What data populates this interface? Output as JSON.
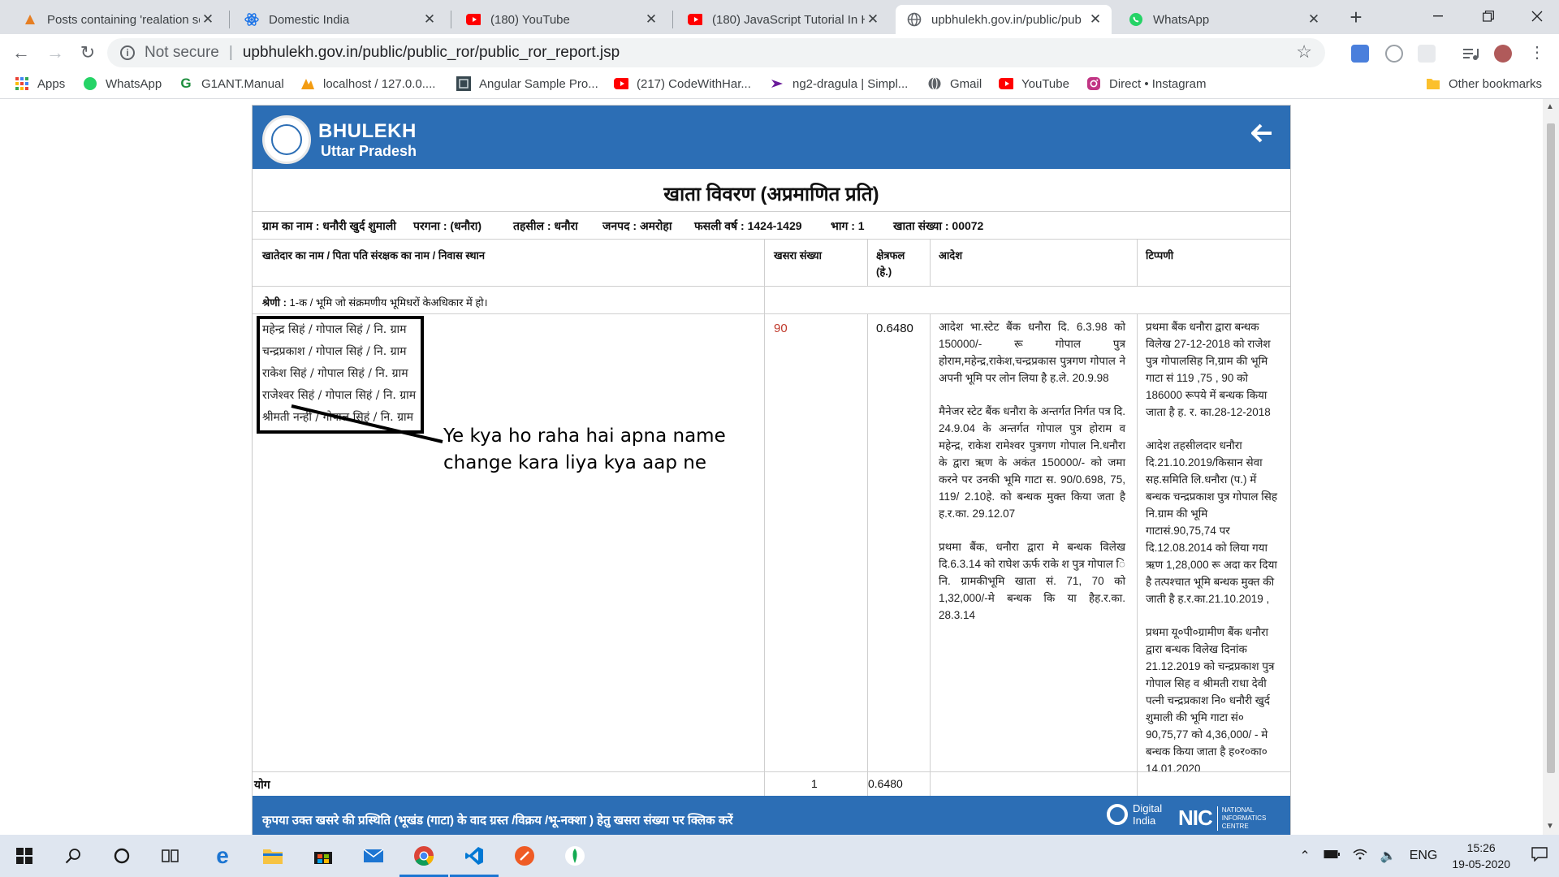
{
  "browser": {
    "tabs": [
      {
        "title": "Posts containing 'realation sc",
        "favicon": "blog-icon",
        "color": "#e67e22"
      },
      {
        "title": "Domestic India",
        "favicon": "react-icon",
        "color": "#1a73e8"
      },
      {
        "title": "(180) YouTube",
        "favicon": "youtube-icon",
        "color": "#ff0000"
      },
      {
        "title": "(180) JavaScript Tutorial In H",
        "favicon": "youtube-icon",
        "color": "#ff0000"
      },
      {
        "title": "upbhulekh.gov.in/public/pub",
        "favicon": "globe-icon",
        "color": "#5f6368"
      },
      {
        "title": "WhatsApp",
        "favicon": "whatsapp-icon",
        "color": "#25d366"
      }
    ],
    "address": {
      "security_label": "Not secure",
      "url": "upbhulekh.gov.in/public/public_ror/public_ror_report.jsp"
    },
    "bookmarks": [
      {
        "label": "Apps",
        "icon": "apps-grid-icon"
      },
      {
        "label": "WhatsApp",
        "icon": "whatsapp-icon"
      },
      {
        "label": "G1ANT.Manual",
        "icon": "g1ant-icon"
      },
      {
        "label": "localhost / 127.0.0....",
        "icon": "phpmyadmin-icon"
      },
      {
        "label": "Angular Sample Pro...",
        "icon": "angular-icon"
      },
      {
        "label": "(217) CodeWithHar...",
        "icon": "youtube-icon"
      },
      {
        "label": "ng2-dragula | Simpl...",
        "icon": "dragula-icon"
      },
      {
        "label": "Gmail",
        "icon": "globe-icon"
      },
      {
        "label": "YouTube",
        "icon": "youtube-icon"
      },
      {
        "label": "Direct • Instagram",
        "icon": "instagram-icon"
      }
    ],
    "other_bookmarks": "Other bookmarks"
  },
  "page": {
    "brand_title": "BHULEKH",
    "brand_subtitle": "Uttar Pradesh",
    "doc_title": "खाता विवरण (अप्रमाणित प्रति)",
    "meta": {
      "village": "ग्राम का नाम : धनौरी खुर्द शुमाली",
      "pargana": "परगना : (धनौरा)",
      "tehsil": "तहसील : धनौरा",
      "district": "जनपद : अमरोहा",
      "fasli_year": "फसली वर्ष : 1424-1429",
      "part": "भाग : 1",
      "khata_no": "खाता संख्या : 00072"
    },
    "columns": {
      "owner": "खातेदार का नाम / पिता पति संरक्षक का नाम / निवास स्थान",
      "khasra": "खसरा संख्या",
      "area": "क्षेत्रफल (हे.)",
      "order": "आदेश",
      "remark": "टिप्पणी"
    },
    "category_label": "श्रेणी :",
    "category_text": " 1-क / भूमि जो संक्रमणीय भूमिधरों केअधिकार में हो।",
    "owners": [
      "महेन्द्र सिहं / गोपाल सिहं / नि. ग्राम",
      "चन्द्रप्रकाश / गोपाल सिहं / नि. ग्राम",
      "राकेश सिहं / गोपाल सिहं / नि. ग्राम",
      "राजेश्वर सिहं / गोपाल सिहं / नि. ग्राम",
      "श्रीमती नन्हीं / गोपाल सिहं / नि. ग्राम"
    ],
    "annotation": "Ye kya ho raha hai apna name change kara liya kya aap ne",
    "khasra_value": "90",
    "area_value": "0.6480",
    "orders": [
      "आदेश भा.स्टेट बैंक धनौरा दि. 6.3.98 को 150000/- रू गोपाल पुत्र होराम,महेन्द्र,राकेश,चन्द्रप्रकास पुत्रगण गोपाल ने अपनी भूमि पर लोन लिया है ह.ले. 20.9.98",
      "मैनेजर स्टेट बैंक धनौरा के अन्तर्गत निर्गत पत्र दि. 24.9.04 के अन्तर्गत गोपाल पुत्र होराम व महेन्द्र, राकेश रामेश्वर पुत्रगण गोपाल नि.धनौरा के द्वारा ऋण के अकंत 150000/- को जमा करने पर उनकी भूमि गाटा स. 90/0.698, 75, 119/ 2.10हे. को बन्धक मुक्त किया जता है ह.र.का. 29.12.07",
      "प्रथमा बैंक, धनौरा द्वारा मे बन्धक विलेख दि.6.3.14 को राघेश ऊर्फ राके श पुत्र गोपाल ि नि. ग्रामकीभूमि खाता सं. 71, 70 को 1,32,000/-मे बन्धक कि या हैह.र.का. 28.3.14"
    ],
    "remarks": [
      "प्रथमा बैंक धनौरा द्वारा बन्धक विलेख 27-12-2018 को राजेश पुत्र गोपालसिह नि,ग्राम की भूमि गाटा सं 119 ,75 , 90 को 186000 रूपये में बन्धक किया जाता है ह. र. का.28-12-2018",
      "आदेश तहसीलदार धनौरा दि.21.10.2019/किसान सेवा सह.समिति लि.धनौरा (प.) में बन्धक चन्द्रप्रकाश पुत्र गोपाल सिह नि.ग्राम की भूमि गाटासं.90,75,74 पर दि.12.08.2014 को लिया गया ऋण 1,28,000 रू अदा कर दिया है तत्पश्चात भूमि बन्धक मुक्त की जाती है ह.र.का.21.10.2019 ,",
      "प्रथमा यू०पी०ग्रामीण बैंक धनौरा द्वारा बन्धक विलेख दिनांक 21.12.2019 को चन्द्रप्रकाश पुत्र गोपाल सिह व श्रीमती राधा देवी पत्नी चन्द्रप्रकाश नि० धनौरी खुर्द शुमाली की भूमि गाटा सं० 90,75,77 को 4,36,000/ - मे बन्धक किया जाता है ह०र०का० 14.01.2020"
    ],
    "total_label": "योग",
    "total_khasra": "1",
    "total_area": "0.6480",
    "footer_text": "कृपया उक्त खसरे की प्रस्थिति (भूखंड (गाटा) के वाद ग्रस्त /विक्रय /भू-नक्शा ) हेतु खसरा संख्या पर क्लिक करें",
    "digital_india": "Digital India",
    "nic": {
      "mark": "NIC",
      "full": "NATIONAL INFORMATICS CENTRE"
    }
  },
  "taskbar": {
    "language": "ENG",
    "time": "15:26",
    "date": "19-05-2020"
  },
  "colors": {
    "header_blue": "#2c6eb5",
    "khasra_red": "#c0392b"
  }
}
